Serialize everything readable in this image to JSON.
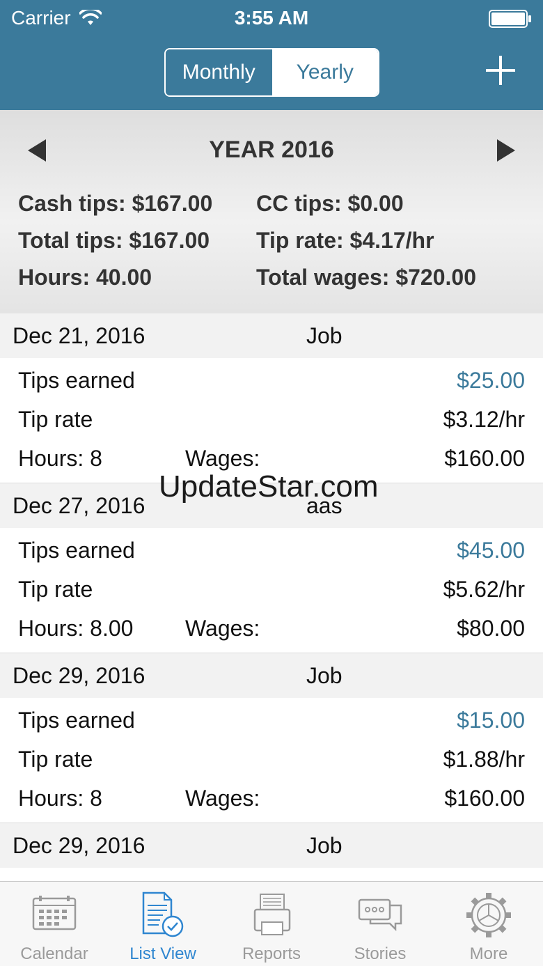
{
  "status": {
    "carrier": "Carrier",
    "time": "3:55 AM"
  },
  "header": {
    "segments": [
      "Monthly",
      "Yearly"
    ],
    "selected_segment": "Yearly"
  },
  "summary": {
    "period_title": "YEAR 2016",
    "cash_tips": "Cash tips: $167.00",
    "cc_tips": "CC tips: $0.00",
    "total_tips": "Total tips: $167.00",
    "tip_rate": "Tip rate: $4.17/hr",
    "hours": "Hours: 40.00",
    "total_wages": "Total wages: $720.00"
  },
  "labels": {
    "tips_earned": "Tips earned",
    "tip_rate": "Tip rate",
    "wages": "Wages:"
  },
  "entries": [
    {
      "date": "Dec 21, 2016",
      "job": "Job",
      "tips": "$25.00",
      "rate": "$3.12/hr",
      "hours": "Hours: 8",
      "wages": "$160.00"
    },
    {
      "date": "Dec 27, 2016",
      "job": "aas",
      "tips": "$45.00",
      "rate": "$5.62/hr",
      "hours": "Hours: 8.00",
      "wages": "$80.00"
    },
    {
      "date": "Dec 29, 2016",
      "job": "Job",
      "tips": "$15.00",
      "rate": "$1.88/hr",
      "hours": "Hours: 8",
      "wages": "$160.00"
    },
    {
      "date": "Dec 29, 2016",
      "job": "Job"
    }
  ],
  "watermark": "UpdateStar.com",
  "tabbar": {
    "items": [
      {
        "label": "Calendar",
        "icon": "calendar-icon"
      },
      {
        "label": "List View",
        "icon": "list-view-icon"
      },
      {
        "label": "Reports",
        "icon": "reports-icon"
      },
      {
        "label": "Stories",
        "icon": "stories-icon"
      },
      {
        "label": "More",
        "icon": "gear-icon"
      }
    ],
    "active": "List View"
  },
  "colors": {
    "header": "#3b7a9b",
    "accent_blue": "#3b7a9b",
    "tab_active": "#2f86d0",
    "tab_inactive": "#9a9a9a"
  }
}
